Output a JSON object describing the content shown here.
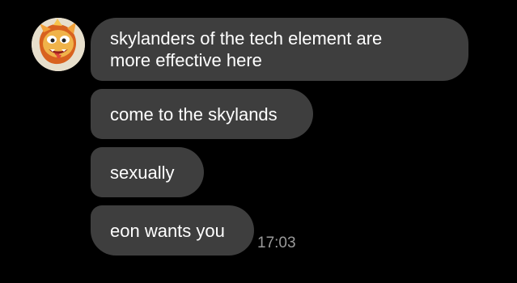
{
  "contact": {
    "avatar_icon": "skylander-avatar-icon"
  },
  "messages": [
    {
      "text": "skylanders of the tech element are\nmore effective here"
    },
    {
      "text": "come to the skylands"
    },
    {
      "text": "sexually"
    },
    {
      "text": "eon wants you"
    }
  ],
  "timestamp": "17:03",
  "colors": {
    "background": "#000000",
    "bubble": "#3e3e3e",
    "text": "#ffffff",
    "timestamp": "#9a9a9a"
  }
}
